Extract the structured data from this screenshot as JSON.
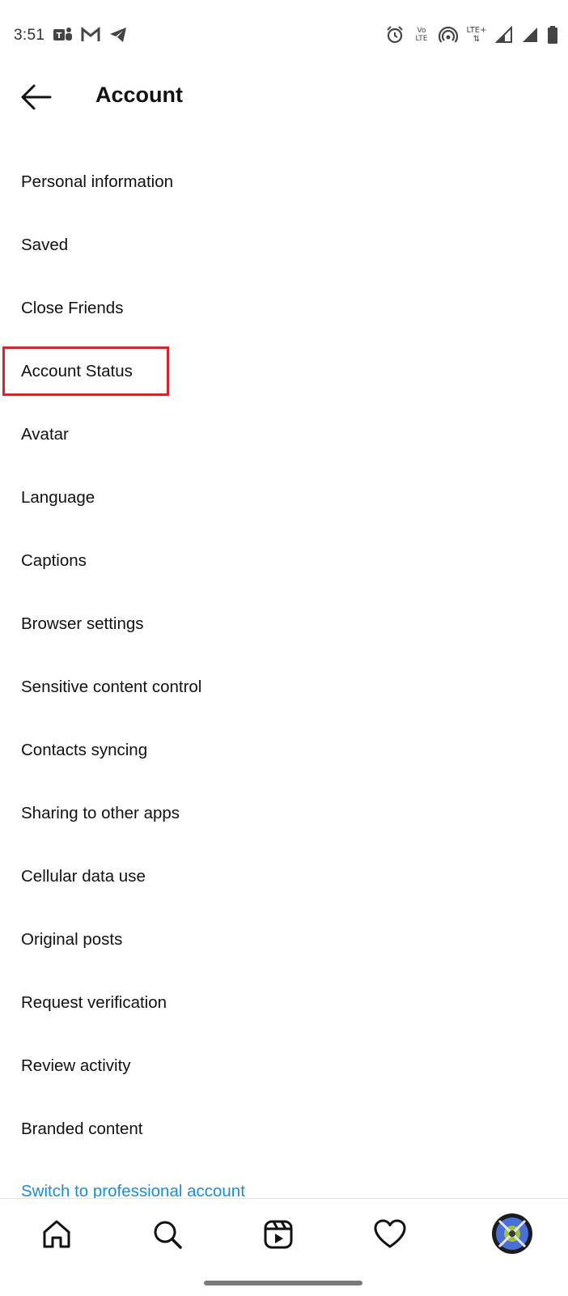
{
  "status_bar": {
    "time": "3:51",
    "left_icons": [
      "teams-icon",
      "gmail-icon",
      "telegram-icon"
    ],
    "volte_label_top": "Vo",
    "volte_label_bottom": "LTE",
    "lte_label": "LTE+",
    "right_icons": [
      "alarm-icon",
      "volte-icon",
      "hotspot-icon",
      "lte-icon",
      "signal-icon",
      "signal-icon-2",
      "battery-icon"
    ]
  },
  "header": {
    "title": "Account",
    "back_icon": "arrow-left-icon"
  },
  "menu": {
    "items": [
      {
        "label": "Personal information"
      },
      {
        "label": "Saved"
      },
      {
        "label": "Close Friends"
      },
      {
        "label": "Account Status"
      },
      {
        "label": "Avatar"
      },
      {
        "label": "Language"
      },
      {
        "label": "Captions"
      },
      {
        "label": "Browser settings"
      },
      {
        "label": "Sensitive content control"
      },
      {
        "label": "Contacts syncing"
      },
      {
        "label": "Sharing to other apps"
      },
      {
        "label": "Cellular data use"
      },
      {
        "label": "Original posts"
      },
      {
        "label": "Request verification"
      },
      {
        "label": "Review activity"
      },
      {
        "label": "Branded content"
      }
    ],
    "highlighted_index": 3,
    "professional_link": "Switch to professional account"
  },
  "bottom_nav": {
    "items": [
      "home-icon",
      "search-icon",
      "reels-icon",
      "heart-icon",
      "profile-avatar"
    ]
  },
  "colors": {
    "link": "#1a8ed8",
    "highlight_box": "#d0262c",
    "text": "#111111",
    "avatar_bg": "#1c1c1c",
    "avatar_ring": "#4a6fd8"
  }
}
